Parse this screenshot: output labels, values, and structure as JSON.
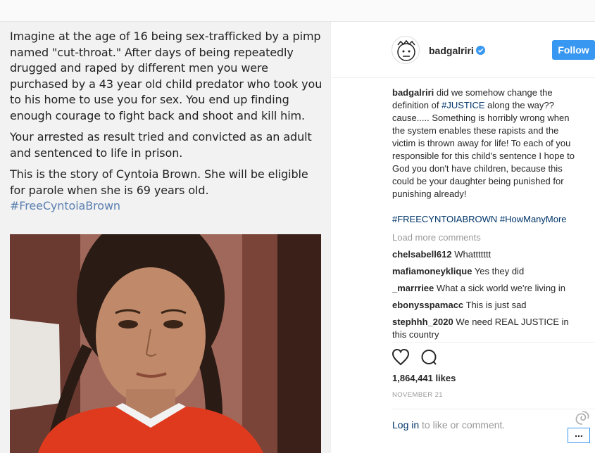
{
  "post": {
    "image_text": {
      "paragraph_1": "Imagine at the age of 16 being sex-trafficked by a pimp named \"cut-throat.\" After days of being repeatedly drugged and raped by different men you were purchased by a 43 year old child predator who took you to his home to use you for sex. You end up finding enough courage to fight back and shoot and kill him.",
      "paragraph_2": "Your arrested as result tried and convicted as an adult and sentenced to life in prison.",
      "paragraph_3": "This is the story of Cyntoia Brown. She will be eligible for parole when she is 69 years old.",
      "hashtag": "#FreeCyntoiaBrown"
    },
    "header": {
      "username": "badgalriri",
      "verified_icon": "verified-badge-icon",
      "follow_label": "Follow"
    },
    "caption": {
      "username": "badgalriri",
      "text_before_tag": " did we somehow change the definition of ",
      "inline_tag": "#JUSTICE",
      "text_after_tag": " along the way?? cause..... Something is horribly wrong when the system enables these rapists and the victim is thrown away for life! To each of you responsible for this child's sentence I hope to God you don't have children, because this could be your daughter being punished for punishing already!",
      "hashtags": "#FREECYNTOIABROWN #HowManyMore"
    },
    "load_more": "Load more comments",
    "comments": [
      {
        "user": "chelsabell612",
        "text": "Whattttttt"
      },
      {
        "user": "mafiamoneyklique",
        "text": "Yes they did"
      },
      {
        "user": "_marrriee",
        "text": "What a sick world we're living in"
      },
      {
        "user": "ebonysspamacc",
        "text": "This is just sad"
      },
      {
        "user": "stephhh_2020",
        "text": "We need REAL JUSTICE in this country"
      }
    ],
    "likes": "1,864,441 likes",
    "date": "NOVEMBER 21",
    "login": {
      "link": "Log in",
      "rest": " to like or comment."
    },
    "more_button": "...",
    "colors": {
      "follow_bg": "#3897f0",
      "link": "#003569",
      "muted": "#999999"
    }
  }
}
